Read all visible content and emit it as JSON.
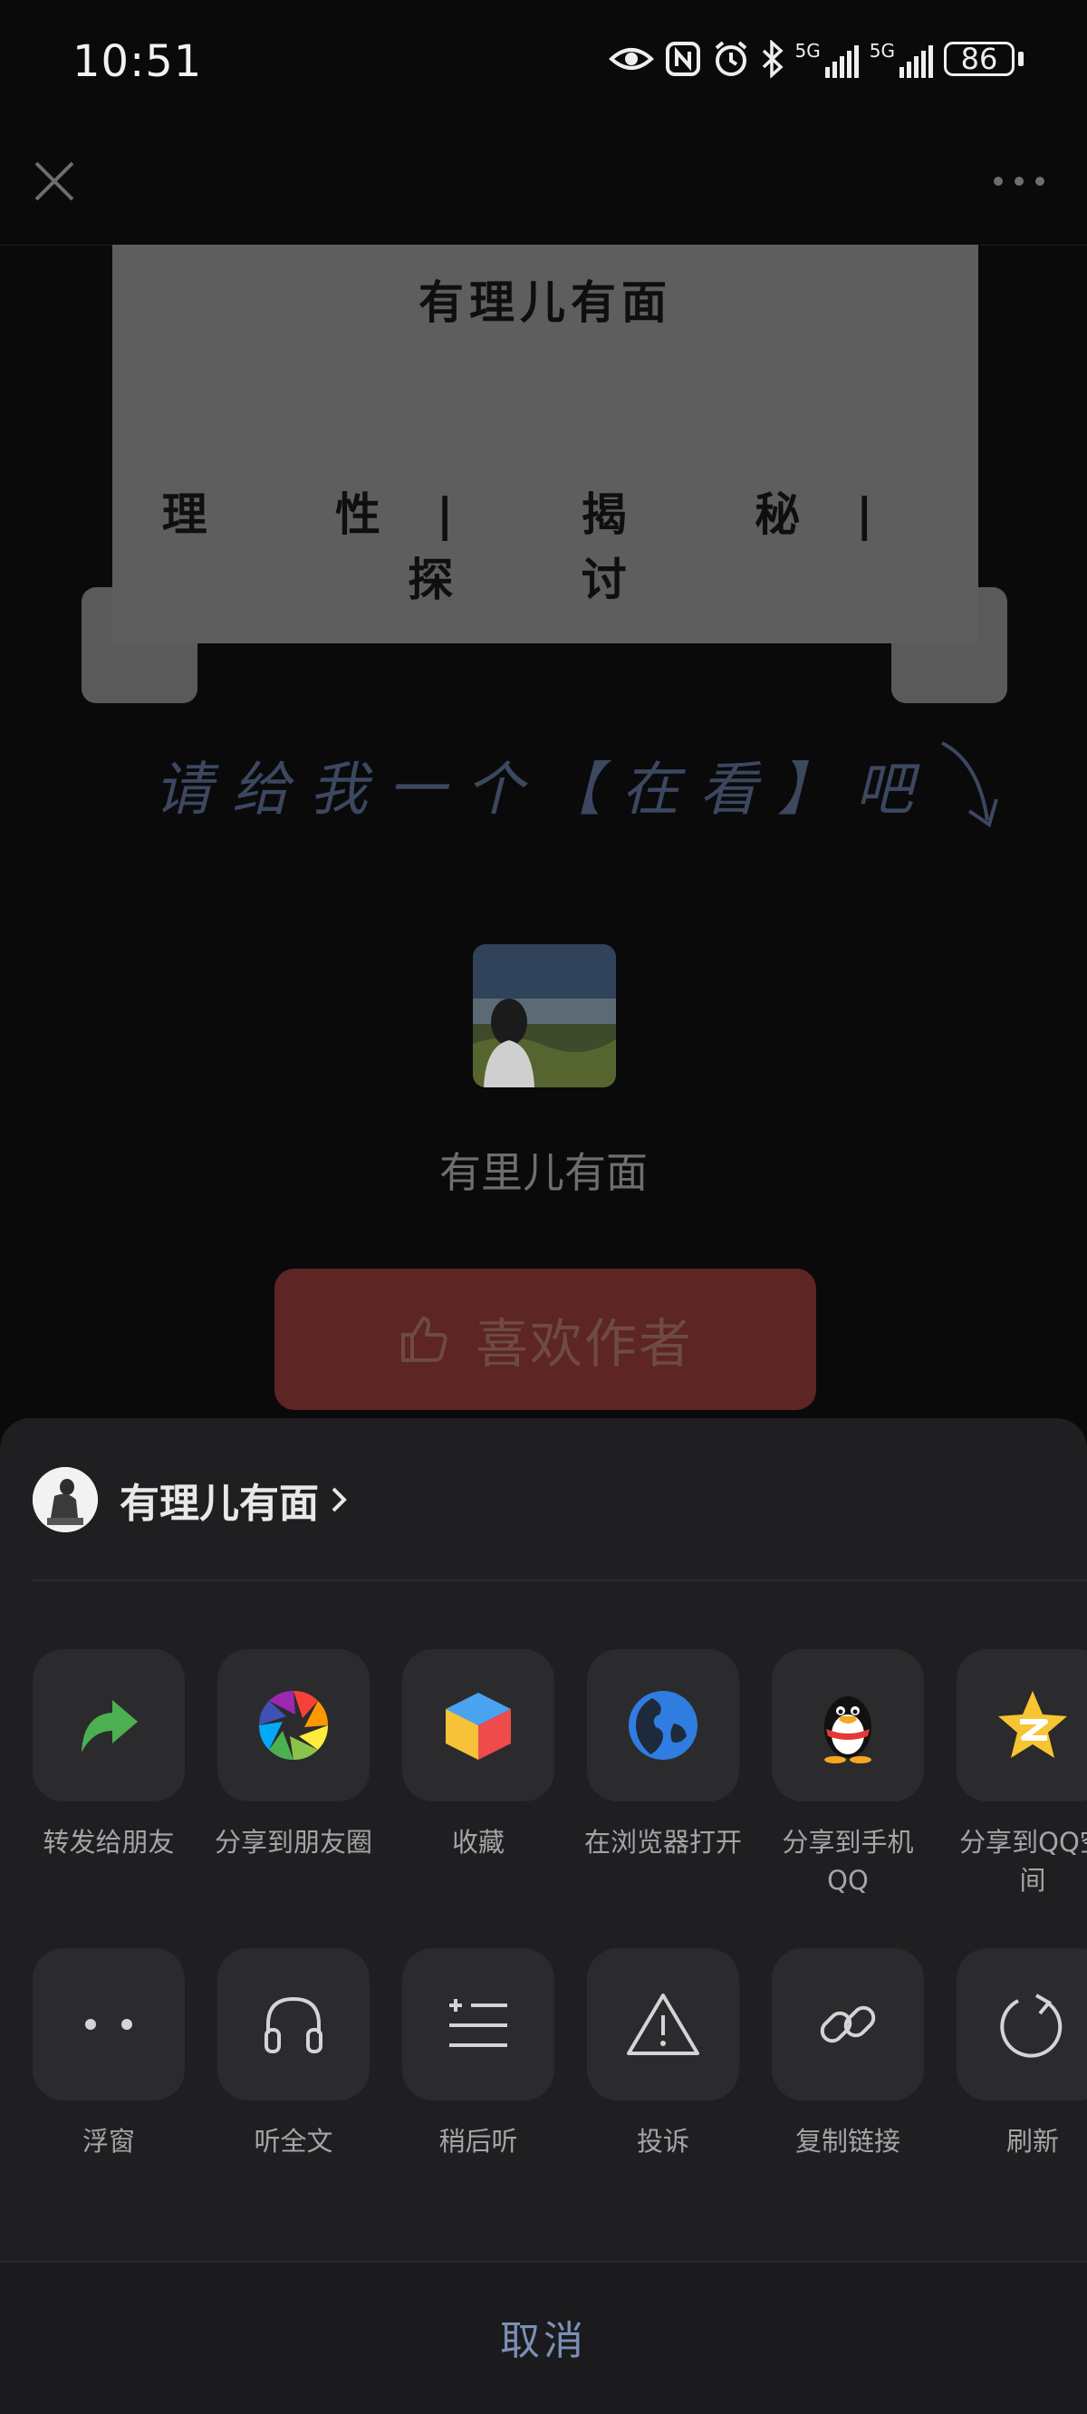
{
  "status": {
    "time": "10:51",
    "battery": "86",
    "net1": "5G",
    "net2": "5G"
  },
  "article": {
    "banner_title": "有理儿有面",
    "banner_tags": "理 性| 揭 秘| 探 讨",
    "ask_text": "请给我一个【在看】吧",
    "author_name": "有里儿有面",
    "like_label": "喜欢作者"
  },
  "sheet": {
    "account_name": "有理儿有面",
    "row1": [
      {
        "label": "转发给朋友",
        "icon": "forward-icon"
      },
      {
        "label": "分享到朋友圈",
        "icon": "moments-icon"
      },
      {
        "label": "收藏",
        "icon": "favorite-cube-icon"
      },
      {
        "label": "在浏览器打开",
        "icon": "browser-globe-icon"
      },
      {
        "label": "分享到手机QQ",
        "icon": "qq-penguin-icon"
      },
      {
        "label": "分享到QQ空间",
        "icon": "qzone-star-icon"
      }
    ],
    "row2": [
      {
        "label": "浮窗",
        "icon": "float-window-icon"
      },
      {
        "label": "听全文",
        "icon": "headphones-icon"
      },
      {
        "label": "稍后听",
        "icon": "listen-later-icon"
      },
      {
        "label": "投诉",
        "icon": "warning-icon"
      },
      {
        "label": "复制链接",
        "icon": "link-icon"
      },
      {
        "label": "刷新",
        "icon": "refresh-icon"
      }
    ],
    "cancel_label": "取消"
  },
  "colors": {
    "sheet_bg": "#1f1f21",
    "tile_bg": "#2b2b2d",
    "like_button": "#5d2523",
    "cancel_text": "#7c90b6"
  }
}
